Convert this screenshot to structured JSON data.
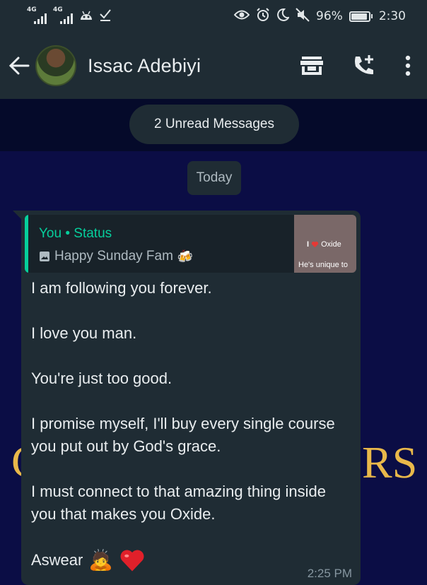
{
  "status_bar": {
    "network_1": "4G",
    "network_2": "4G",
    "battery_percent": "96%",
    "time": "2:30",
    "icons_left": [
      "signal-icon",
      "signal-icon",
      "android-debug-icon",
      "checkmark-icon"
    ],
    "icons_right": [
      "eye-icon",
      "alarm-icon",
      "moon-icon",
      "muted-icon",
      "battery-icon"
    ]
  },
  "header": {
    "contact_name": "Issac Adebiyi",
    "actions": [
      "store-icon",
      "add-call-icon",
      "more-vert-icon"
    ]
  },
  "unread": {
    "label": "2 Unread Messages"
  },
  "date_chip": {
    "label": "Today"
  },
  "message": {
    "quote": {
      "author": "You • Status",
      "text": "Happy Sunday Fam",
      "thumb_title": "Oxide",
      "thumb_caption": "He's unique to"
    },
    "paragraphs": [
      "I am following you forever.",
      "I love you man.",
      "You're just too good.",
      "I promise myself, I'll buy every single course you put out by God's grace.",
      "I must connect to that amazing thing inside you that makes you Oxide."
    ],
    "last_line": "Aswear",
    "time": "2:25 PM"
  },
  "background": {
    "left_fragment": "C",
    "right_fragment": "RS"
  },
  "colors": {
    "bar": "#1f2c34",
    "chat_bg": "#0b0d45",
    "accent": "#06cf9c",
    "bubble": "#1f2c34"
  }
}
